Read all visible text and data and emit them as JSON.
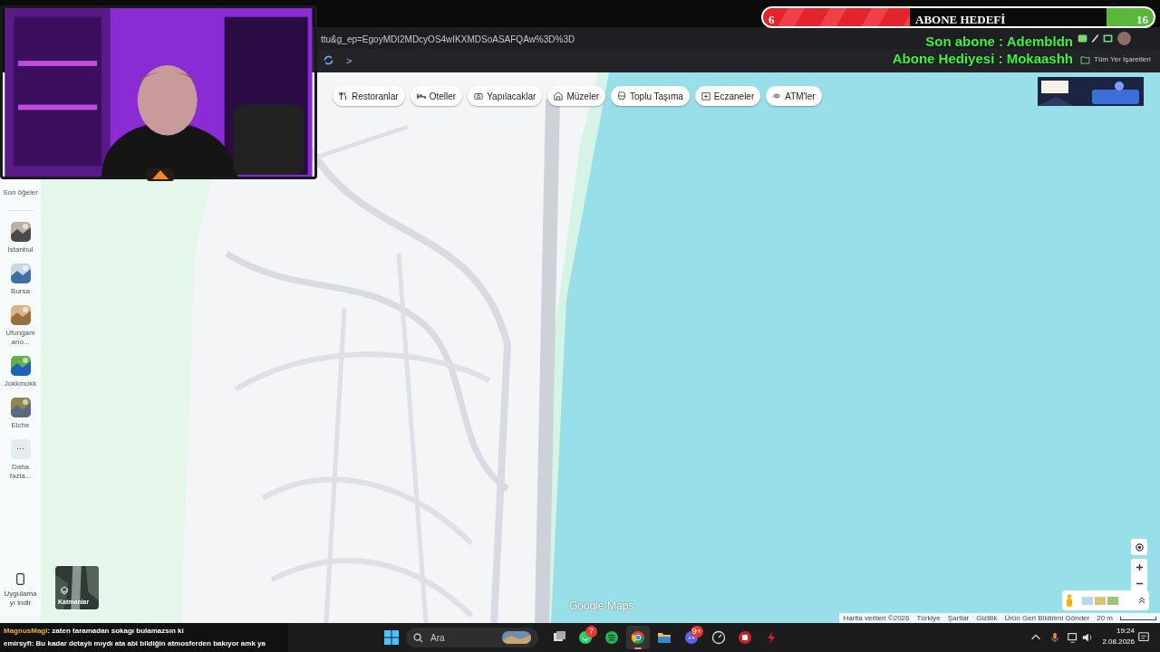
{
  "browser": {
    "url": "ttu&g_ep=EgoyMDI2MDcyOS4wIKXMDSoASAFQAw%3D%3D",
    "bookmark_chevron": ">",
    "bookmarks_folder": "Tüm Yer İşaretleri"
  },
  "subscriber_goal": {
    "current": "6",
    "title": "ABONE HEDEFİ",
    "target": "16",
    "level": 0.375
  },
  "stream_info": [
    "Son abone : Adembldn",
    "Abone Hediyesi : Mokaashh"
  ],
  "sidebar": {
    "recent": "Son öğeler",
    "items": [
      {
        "kind": "place",
        "label": "İstanbul"
      },
      {
        "kind": "place",
        "label": "Bursa"
      },
      {
        "kind": "place",
        "label": "Ufungam ano..."
      },
      {
        "kind": "place",
        "label": "Jokkmokk"
      },
      {
        "kind": "place",
        "label": "Elche"
      },
      {
        "kind": "more",
        "label": "Daha fazla...",
        "icon_text": "···"
      }
    ],
    "app_lines": [
      "Uygulama",
      "yı indir"
    ]
  },
  "categories": [
    "Restoranlar",
    "Oteller",
    "Yapılacaklar",
    "Müzeler",
    "Toplu Taşıma",
    "Eczaneler",
    "ATM'ler"
  ],
  "layers": "Katmanlar",
  "brand": "Google Maps",
  "attribution": [
    "Harita verileri ©2026",
    "Türkiye",
    "Şartlar",
    "Gizlilik",
    "Ürün Geri Bildirimi Gönder"
  ],
  "scale": "20 m",
  "chat": [
    {
      "user": "MagnusMagi",
      "color": "#f0b429",
      "message": ": zaten taramadan sokagı bulamazsın ki"
    },
    {
      "user": "emirsyfi",
      "color": "#ffffff",
      "message": ": Bu kadar detaylı mıydı ata abi bildiğin atmosferden bakıyor amk ya"
    }
  ],
  "taskbar": {
    "search": "Ara",
    "apps": [
      {
        "selected": false
      },
      {
        "selected": false,
        "badge": "7"
      },
      {
        "selected": false
      },
      {
        "selected": true
      },
      {
        "selected": false
      },
      {
        "selected": false,
        "badge": "9+"
      },
      {
        "selected": false
      },
      {
        "selected": false
      },
      {
        "selected": false
      }
    ],
    "time": "19:24",
    "date": "2.08.2026"
  }
}
